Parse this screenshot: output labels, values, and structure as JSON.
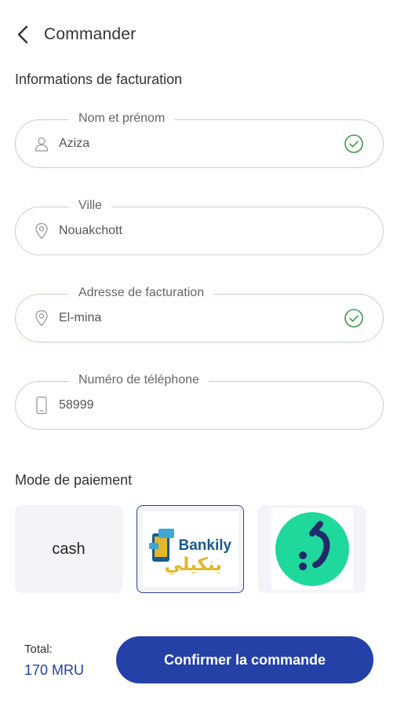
{
  "header": {
    "title": "Commander",
    "back_icon": "chevron-left-icon"
  },
  "billing": {
    "section_title": "Informations de facturation",
    "fields": [
      {
        "label": "Nom et prénom",
        "value": "Aziza",
        "icon": "user-icon",
        "valid": true
      },
      {
        "label": "Ville",
        "value": "Nouakchott",
        "icon": "location-pin-icon",
        "valid": false
      },
      {
        "label": "Adresse de facturation",
        "value": "El-mina",
        "icon": "location-pin-icon",
        "valid": true
      },
      {
        "label": "Numéro de téléphone",
        "value": "58999",
        "icon": "phone-icon",
        "valid": false
      }
    ]
  },
  "payment": {
    "section_title": "Mode de paiement",
    "options": [
      {
        "label": "cash",
        "selected": false
      },
      {
        "label": "Bankily",
        "arabic": "بنكيلي",
        "selected": true
      },
      {
        "label": "",
        "icon": "sedad-logo",
        "selected": false
      }
    ]
  },
  "footer": {
    "total_label": "Total:",
    "total_value": "170 MRU",
    "confirm_label": "Confirmer la commande"
  },
  "colors": {
    "primary": "#2441a7",
    "valid_check": "#3d9a48",
    "sedad_green": "#1ed99b",
    "sedad_navy": "#1f2a6b",
    "bankily_blue": "#1a5a8c",
    "bankily_gold": "#e2b72a"
  }
}
